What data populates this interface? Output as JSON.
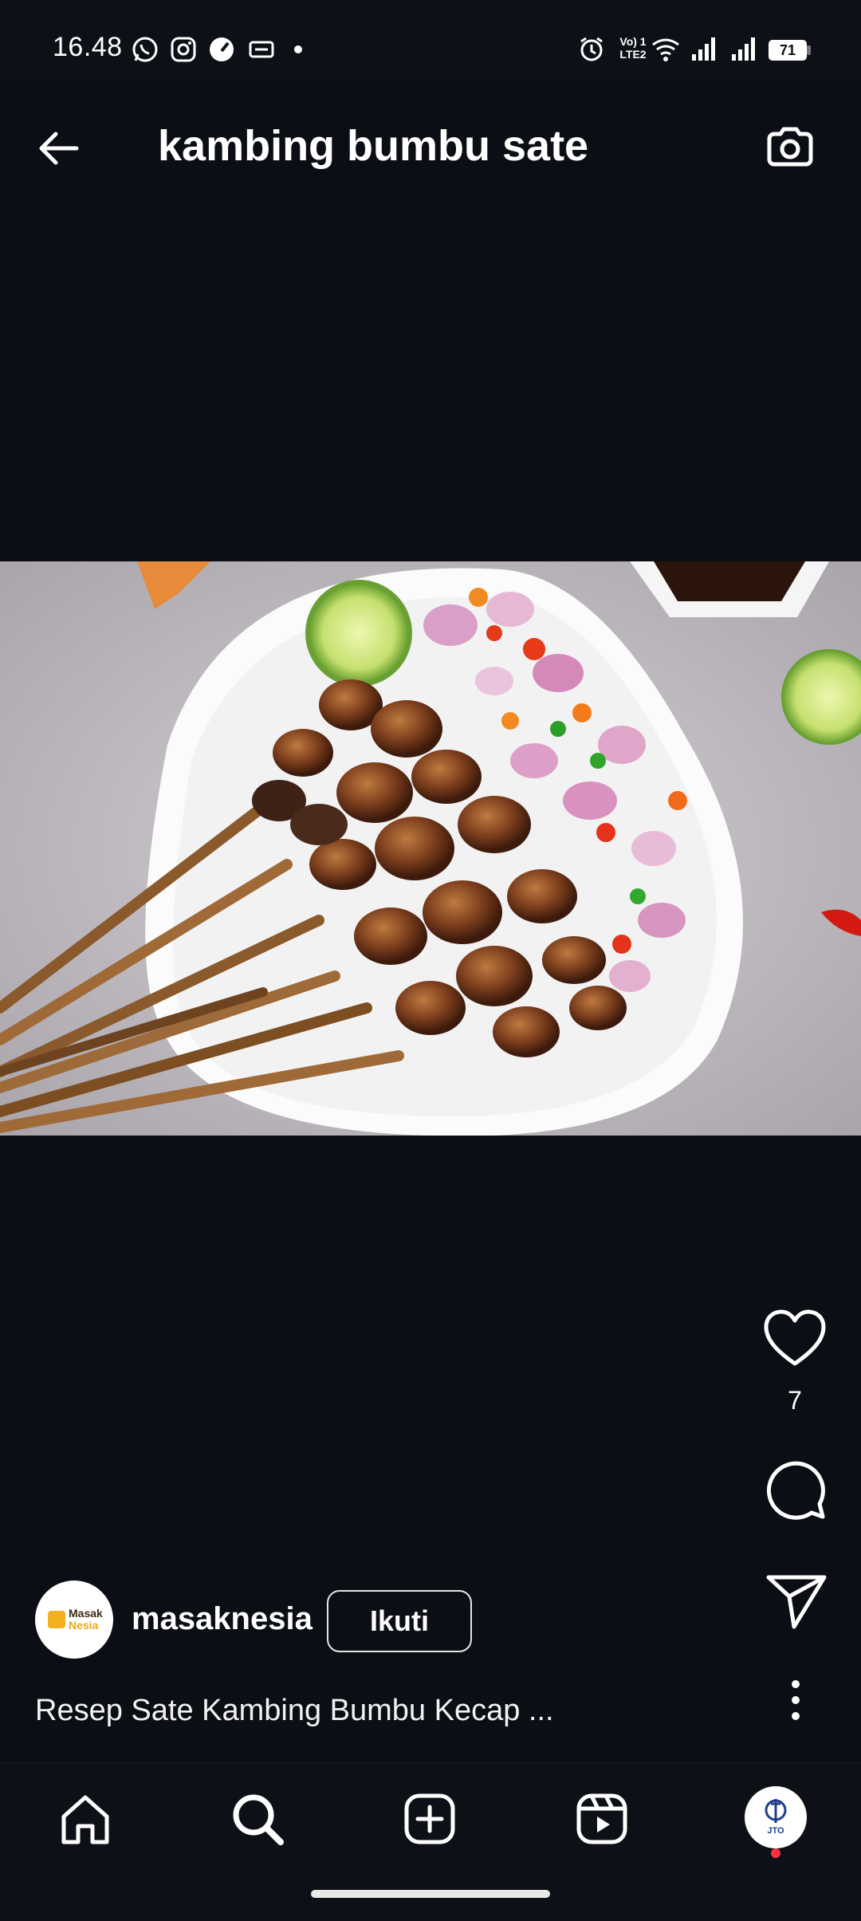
{
  "status_bar": {
    "time": "16.48",
    "battery": "71",
    "network_label_1": "Vo) 1",
    "network_label_2": "LTE2"
  },
  "header": {
    "title": "kambing bumbu sate"
  },
  "post": {
    "like_count": "7",
    "author": {
      "username": "masaknesia",
      "avatar_text_1": "Masak",
      "avatar_text_2": "Nesia"
    },
    "follow_label": "Ikuti",
    "caption": "Resep Sate Kambing Bumbu Kecap ..."
  },
  "bottom_nav": {
    "items": [
      "home-icon",
      "search-icon",
      "create-icon",
      "reels-icon",
      "profile-avatar"
    ],
    "profile_avatar_text": "JTO"
  },
  "colors": {
    "background": "#0b0e14",
    "text": "#ffffff",
    "notification": "#ff3040"
  }
}
